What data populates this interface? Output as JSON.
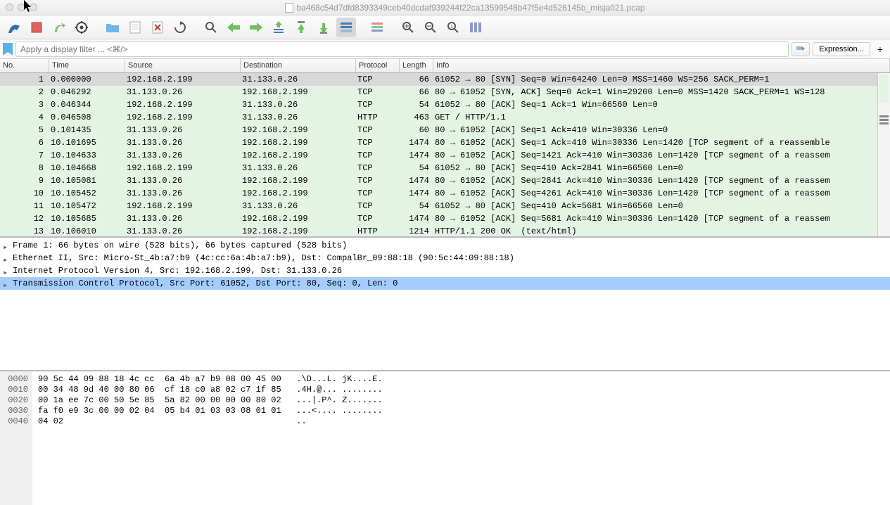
{
  "window": {
    "title": "ba468c54d7dfd8393349ceb40dcdaf939244f22ca13599548b47f5e4d526145b_misja021.pcap"
  },
  "filter": {
    "placeholder": "Apply a display filter ... <⌘/>",
    "expression_label": "Expression...",
    "plus": "+"
  },
  "columns": {
    "no": "No.",
    "time": "Time",
    "source": "Source",
    "destination": "Destination",
    "protocol": "Protocol",
    "length": "Length",
    "info": "Info"
  },
  "packets": [
    {
      "no": "1",
      "time": "0.000000",
      "src": "192.168.2.199",
      "dst": "31.133.0.26",
      "proto": "TCP",
      "len": "66",
      "info": "61052 → 80 [SYN] Seq=0 Win=64240 Len=0 MSS=1460 WS=256 SACK_PERM=1",
      "sel": true
    },
    {
      "no": "2",
      "time": "0.046292",
      "src": "31.133.0.26",
      "dst": "192.168.2.199",
      "proto": "TCP",
      "len": "66",
      "info": "80 → 61052 [SYN, ACK] Seq=0 Ack=1 Win=29200 Len=0 MSS=1420 SACK_PERM=1 WS=128"
    },
    {
      "no": "3",
      "time": "0.046344",
      "src": "192.168.2.199",
      "dst": "31.133.0.26",
      "proto": "TCP",
      "len": "54",
      "info": "61052 → 80 [ACK] Seq=1 Ack=1 Win=66560 Len=0"
    },
    {
      "no": "4",
      "time": "0.046508",
      "src": "192.168.2.199",
      "dst": "31.133.0.26",
      "proto": "HTTP",
      "len": "463",
      "info": "GET / HTTP/1.1"
    },
    {
      "no": "5",
      "time": "0.101435",
      "src": "31.133.0.26",
      "dst": "192.168.2.199",
      "proto": "TCP",
      "len": "60",
      "info": "80 → 61052 [ACK] Seq=1 Ack=410 Win=30336 Len=0"
    },
    {
      "no": "6",
      "time": "10.101695",
      "src": "31.133.0.26",
      "dst": "192.168.2.199",
      "proto": "TCP",
      "len": "1474",
      "info": "80 → 61052 [ACK] Seq=1 Ack=410 Win=30336 Len=1420 [TCP segment of a reassemble"
    },
    {
      "no": "7",
      "time": "10.104633",
      "src": "31.133.0.26",
      "dst": "192.168.2.199",
      "proto": "TCP",
      "len": "1474",
      "info": "80 → 61052 [ACK] Seq=1421 Ack=410 Win=30336 Len=1420 [TCP segment of a reassem"
    },
    {
      "no": "8",
      "time": "10.104668",
      "src": "192.168.2.199",
      "dst": "31.133.0.26",
      "proto": "TCP",
      "len": "54",
      "info": "61052 → 80 [ACK] Seq=410 Ack=2841 Win=66560 Len=0"
    },
    {
      "no": "9",
      "time": "10.105081",
      "src": "31.133.0.26",
      "dst": "192.168.2.199",
      "proto": "TCP",
      "len": "1474",
      "info": "80 → 61052 [ACK] Seq=2841 Ack=410 Win=30336 Len=1420 [TCP segment of a reassem"
    },
    {
      "no": "10",
      "time": "10.105452",
      "src": "31.133.0.26",
      "dst": "192.168.2.199",
      "proto": "TCP",
      "len": "1474",
      "info": "80 → 61052 [ACK] Seq=4261 Ack=410 Win=30336 Len=1420 [TCP segment of a reassem"
    },
    {
      "no": "11",
      "time": "10.105472",
      "src": "192.168.2.199",
      "dst": "31.133.0.26",
      "proto": "TCP",
      "len": "54",
      "info": "61052 → 80 [ACK] Seq=410 Ack=5681 Win=66560 Len=0"
    },
    {
      "no": "12",
      "time": "10.105685",
      "src": "31.133.0.26",
      "dst": "192.168.2.199",
      "proto": "TCP",
      "len": "1474",
      "info": "80 → 61052 [ACK] Seq=5681 Ack=410 Win=30336 Len=1420 [TCP segment of a reassem"
    },
    {
      "no": "13",
      "time": "10.106010",
      "src": "31.133.0.26",
      "dst": "192.168.2.199",
      "proto": "HTTP",
      "len": "1214",
      "info": "HTTP/1.1 200 OK  (text/html)"
    }
  ],
  "details": [
    {
      "label": "Frame 1: 66 bytes on wire (528 bits), 66 bytes captured (528 bits)",
      "sel": false
    },
    {
      "label": "Ethernet II, Src: Micro-St_4b:a7:b9 (4c:cc:6a:4b:a7:b9), Dst: CompalBr_09:88:18 (90:5c:44:09:88:18)",
      "sel": false
    },
    {
      "label": "Internet Protocol Version 4, Src: 192.168.2.199, Dst: 31.133.0.26",
      "sel": false
    },
    {
      "label": "Transmission Control Protocol, Src Port: 61052, Dst Port: 80, Seq: 0, Len: 0",
      "sel": true
    }
  ],
  "hex": {
    "offsets": [
      "0000",
      "0010",
      "0020",
      "0030",
      "0040"
    ],
    "bytes": [
      "90 5c 44 09 88 18 4c cc  6a 4b a7 b9 08 00 45 00",
      "00 34 48 9d 40 00 80 06  cf 18 c0 a8 02 c7 1f 85",
      "00 1a ee 7c 00 50 5e 85  5a 82 00 00 00 00 80 02",
      "fa f0 e9 3c 00 00 02 04  05 b4 01 03 03 08 01 01",
      "04 02"
    ],
    "ascii": [
      ".\\D...L. jK....E.",
      ".4H.@... ........",
      "...|.P^. Z.......",
      "...<.... ........",
      ".."
    ]
  }
}
